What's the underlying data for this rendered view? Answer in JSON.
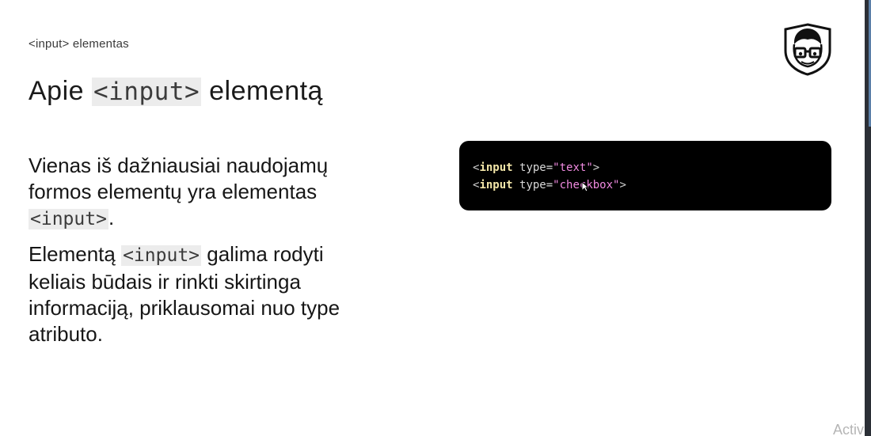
{
  "breadcrumb": "<input> elementas",
  "title": {
    "before": "Apie ",
    "code": "<input>",
    "after": " elementą"
  },
  "paragraph1": {
    "text": "Vienas iš dažniausiai naudojamų formos elementų yra elementas ",
    "code": "<input>",
    "end": "."
  },
  "paragraph2": {
    "before": "Elementą ",
    "code": "<input>",
    "after": " galima rodyti keliais būdais ir rinkti skirtinga informaciją, priklausomai nuo type atributo."
  },
  "code_block": {
    "lines": [
      {
        "open": "<",
        "tag": "input",
        "attr": " type=",
        "value": "\"text\"",
        "close": ">"
      },
      {
        "open": "<",
        "tag": "input",
        "attr": " type=",
        "value": "\"checkbox\"",
        "close": ">"
      }
    ]
  },
  "watermark": "Activ",
  "logo_icon": "nerd-glasses-shield-icon",
  "cursor_icon": "mouse-pointer-icon",
  "colors": {
    "code_background": "#000000",
    "code_tag": "#f3e6a8",
    "code_string": "#f08ae0",
    "inline_code_background": "#ececec"
  }
}
